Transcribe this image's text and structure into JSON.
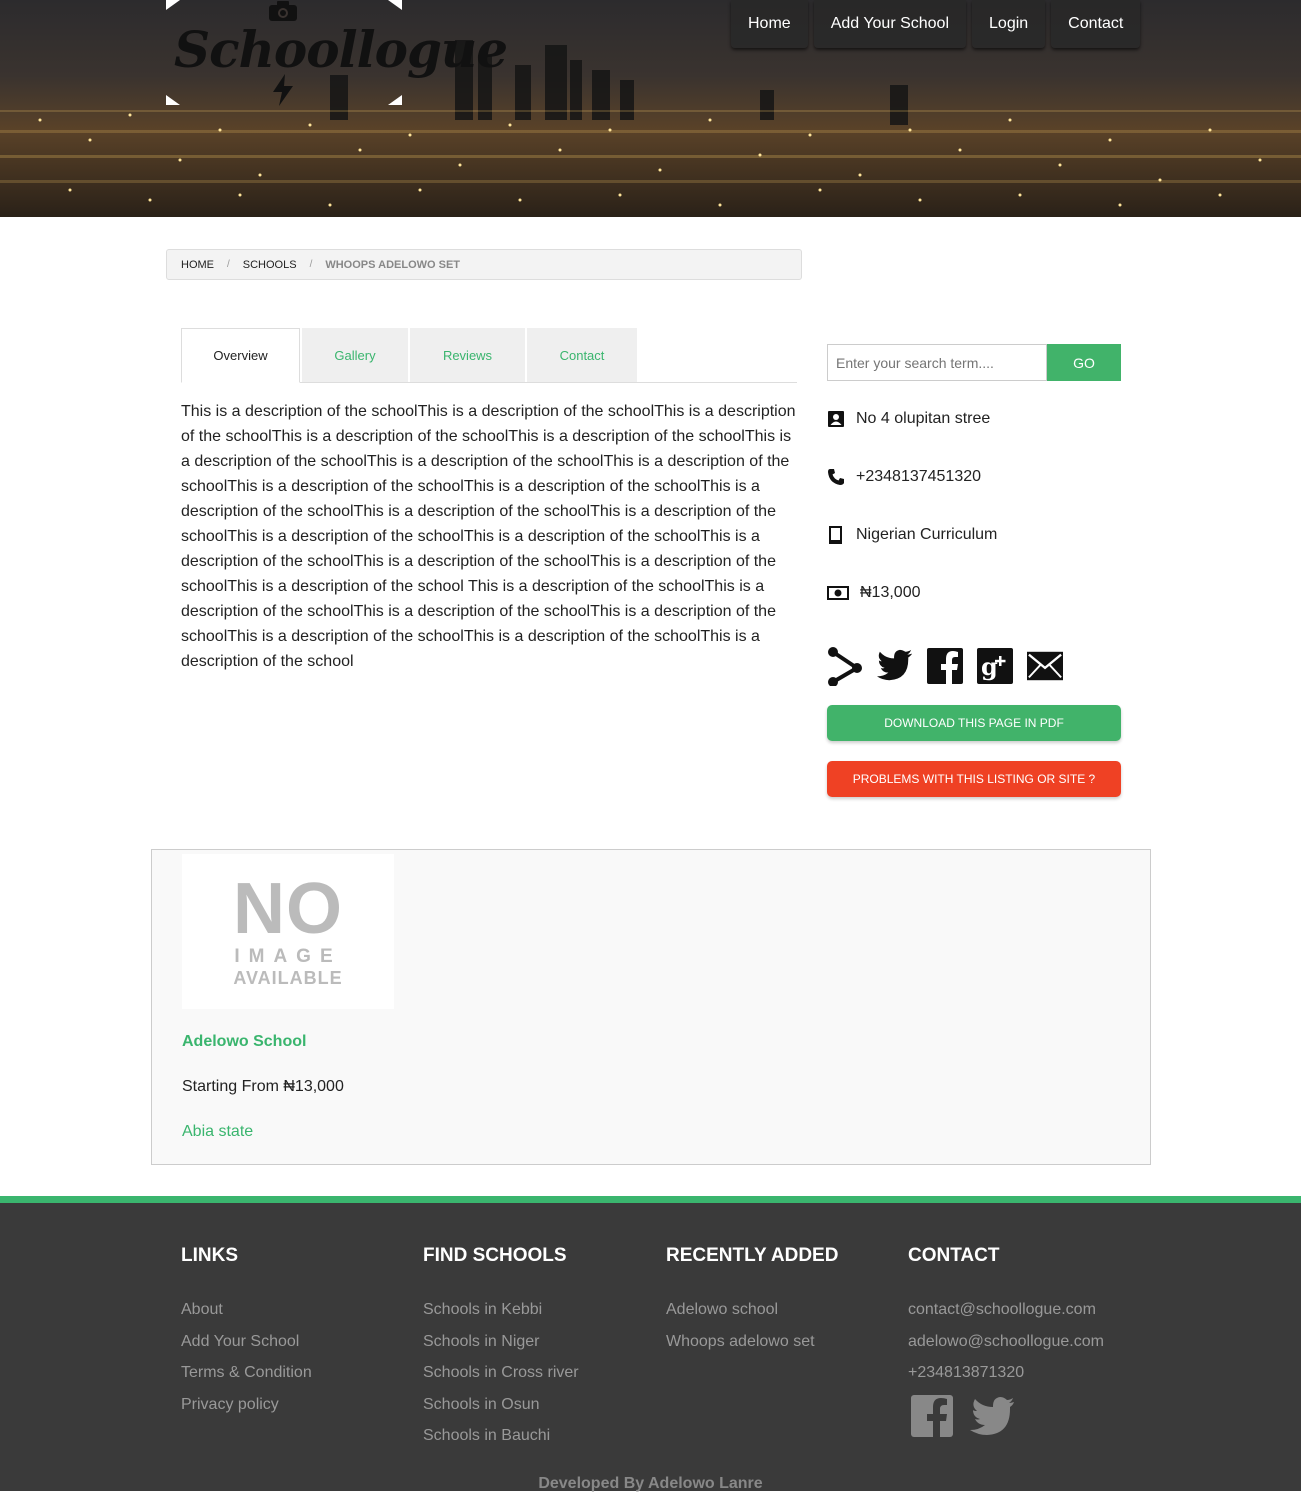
{
  "header": {
    "logo_text": "Schoollogue",
    "nav": [
      "Home",
      "Add Your School",
      "Login",
      "Contact"
    ]
  },
  "breadcrumb": [
    "HOME",
    "SCHOOLS",
    "WHOOPS ADELOWO SET"
  ],
  "tabs": [
    "Overview",
    "Gallery",
    "Reviews",
    "Contact"
  ],
  "description": "This is a description of the schoolThis is a description of the schoolThis is a description of the schoolThis is a description of the schoolThis is a description of the schoolThis is a description of the schoolThis is a description of the schoolThis is a description of the schoolThis is a description of the schoolThis is a description of the schoolThis is a description of the schoolThis is a description of the schoolThis is a description of the schoolThis is a description of the schoolThis is a description of the schoolThis is a description of the schoolThis is a description of the schoolThis is a description of the schoolThis is a description of the school This is a description of the schoolThis is a description of the schoolThis is a description of the schoolThis is a description of the schoolThis is a description of the schoolThis is a description of the schoolThis is a description of the school",
  "sidebar": {
    "search_placeholder": "Enter your search term....",
    "search_button": "GO",
    "address": "No 4 olupitan stree",
    "phone": "+2348137451320",
    "curriculum": "Nigerian Curriculum",
    "fee": "₦13,000",
    "pdf_button": "DOWNLOAD THIS PAGE IN PDF",
    "problem_button": "PROBLEMS WITH THIS LISTING OR SITE ?"
  },
  "listing": {
    "no_image_big": "NO",
    "no_image_mid": "IMAGE",
    "no_image_small": "AVAILABLE",
    "name": "Adelowo School",
    "price": "Starting From ₦13,000",
    "state": "Abia state"
  },
  "footer": {
    "links_title": "LINKS",
    "links": [
      "About",
      "Add Your School",
      "Terms & Condition",
      "Privacy policy"
    ],
    "find_title": "FIND SCHOOLS",
    "find": [
      "Schools in Kebbi",
      "Schools in Niger",
      "Schools in Cross river",
      "Schools in Osun",
      "Schools in Bauchi"
    ],
    "recent_title": "RECENTLY ADDED",
    "recent": [
      "Adelowo school",
      "Whoops adelowo set"
    ],
    "contact_title": "CONTACT",
    "contact": [
      "contact@schoollogue.com",
      "adelowo@schoollogue.com",
      "+234813871320"
    ],
    "developed_by": "Developed By Adelowo Lanre"
  },
  "colors": {
    "accent_green": "#41b36a",
    "link_green": "#3ab56e",
    "alert_red": "#ef4124",
    "footer_bg": "#3a3a3a"
  }
}
